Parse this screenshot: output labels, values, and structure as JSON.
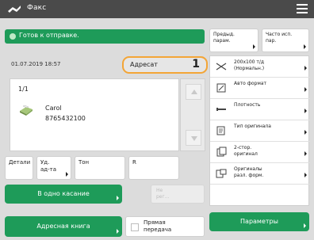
{
  "window": {
    "title": "Факс"
  },
  "status": {
    "text": "Готов к отправке."
  },
  "datetime": "01.07.2019 18:57",
  "addressee": {
    "label": "Адресат",
    "count": "1"
  },
  "destination": {
    "page": "1/1",
    "name": "Carol",
    "number": "8765432100"
  },
  "settings": [
    {
      "label": "Детали"
    },
    {
      "label": "Уд.\nад-та"
    },
    {
      "label": "Тон"
    },
    {
      "label": "R"
    }
  ],
  "buttons": {
    "one_touch": "В одно касание",
    "address_book": "Адресная книга",
    "direct_send": "Прямая\nпередача",
    "params": "Параметры",
    "disabled_small": "Не\nрег..."
  },
  "right_top": [
    {
      "label": "Предыд.\nпарам."
    },
    {
      "label": "Часто исп.\nпар."
    }
  ],
  "right_list": [
    {
      "label": "200x100 т/д\n(Нормальн.)",
      "icon": "resolution-icon"
    },
    {
      "label": "Авто формат",
      "icon": "format-icon"
    },
    {
      "label": "Плотность",
      "icon": "density-icon"
    },
    {
      "label": "Тип оригинала",
      "icon": "original-type-icon"
    },
    {
      "label": "2-стор.\nоригинал",
      "icon": "duplex-icon"
    },
    {
      "label": "Оригиналы\nразл. форм.",
      "icon": "mixed-originals-icon"
    }
  ],
  "colors": {
    "green": "#1e9b59",
    "title_bar": "#4a4a4a",
    "highlight": "#f3a536"
  }
}
